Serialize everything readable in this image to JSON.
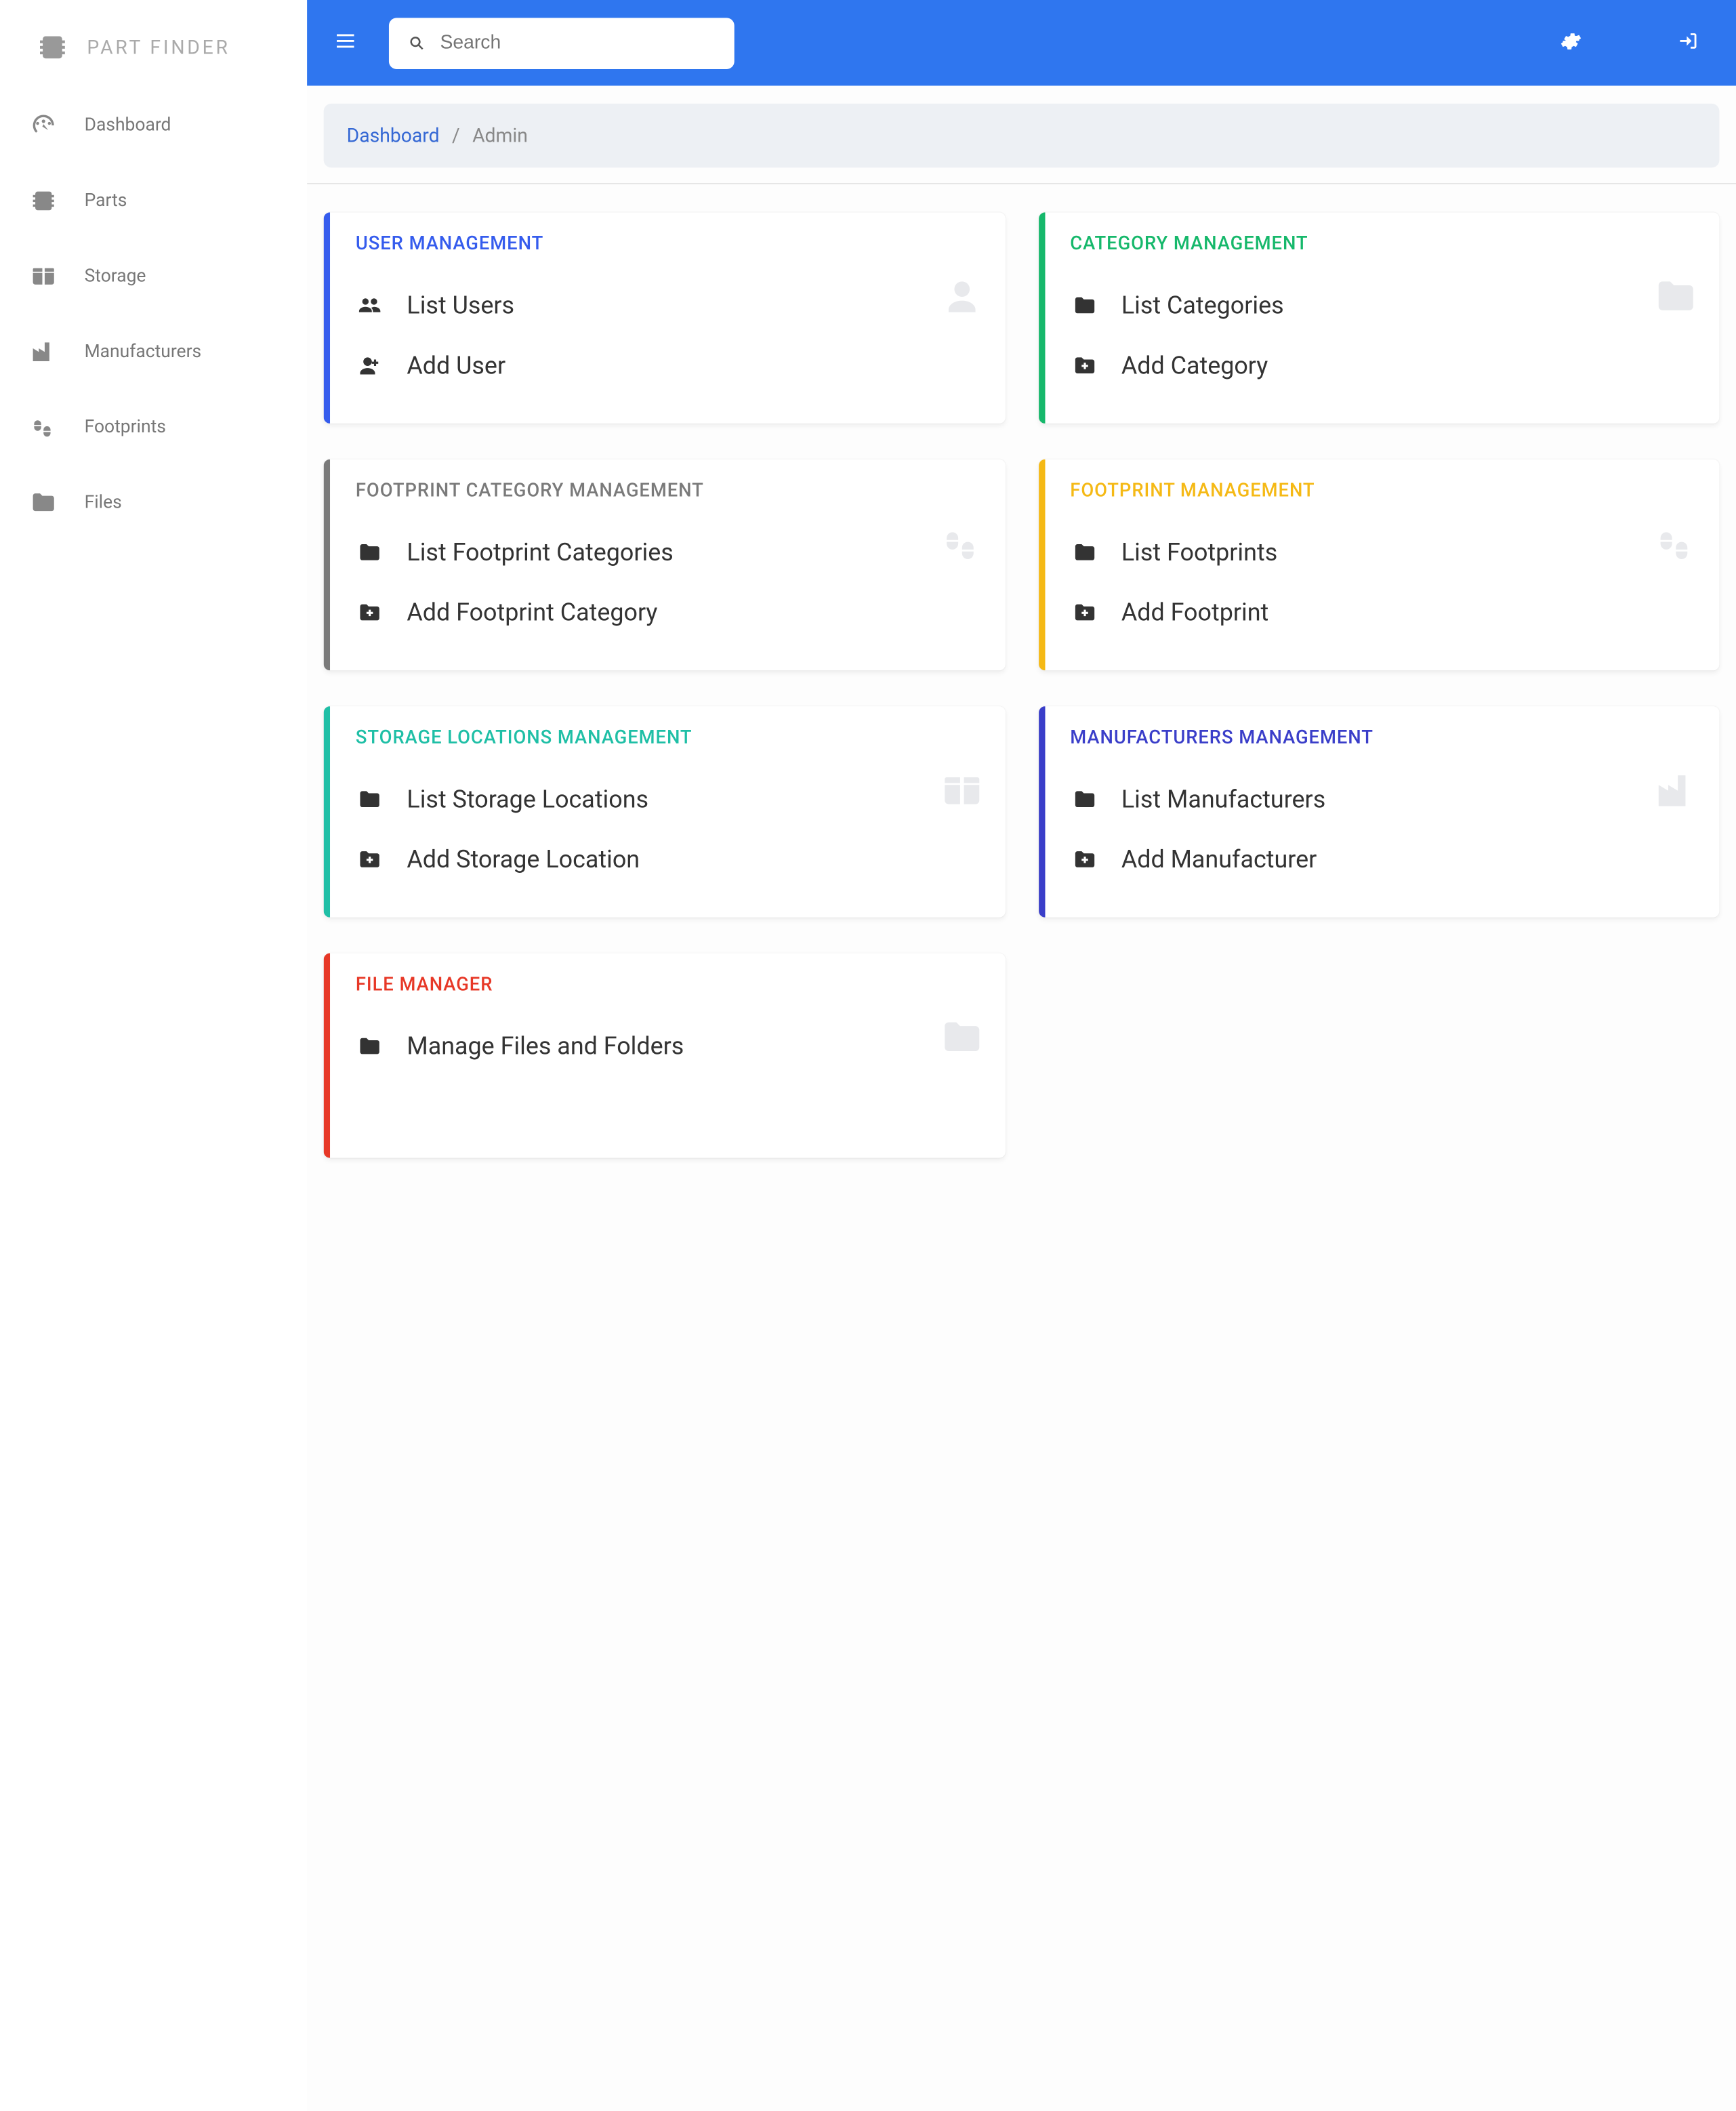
{
  "app": {
    "name": "PART FINDER"
  },
  "search": {
    "placeholder": "Search",
    "value": ""
  },
  "sidebar": {
    "items": [
      {
        "label": "Dashboard",
        "icon": "gauge"
      },
      {
        "label": "Parts",
        "icon": "chip"
      },
      {
        "label": "Storage",
        "icon": "box"
      },
      {
        "label": "Manufacturers",
        "icon": "factory"
      },
      {
        "label": "Footprints",
        "icon": "footprints"
      },
      {
        "label": "Files",
        "icon": "folder"
      }
    ]
  },
  "breadcrumb": {
    "root": "Dashboard",
    "current": "Admin"
  },
  "cards": [
    {
      "title": "USER MANAGEMENT",
      "accent": "blue",
      "bg_icon": "user",
      "links": [
        {
          "label": "List Users",
          "icon": "users"
        },
        {
          "label": "Add User",
          "icon": "user-plus"
        }
      ]
    },
    {
      "title": "CATEGORY MANAGEMENT",
      "accent": "green",
      "bg_icon": "folder",
      "links": [
        {
          "label": "List Categories",
          "icon": "folder"
        },
        {
          "label": "Add Category",
          "icon": "folder-plus"
        }
      ]
    },
    {
      "title": "FOOTPRINT CATEGORY MANAGEMENT",
      "accent": "gray",
      "bg_icon": "footprints",
      "links": [
        {
          "label": "List Footprint Categories",
          "icon": "folder"
        },
        {
          "label": "Add Footprint Category",
          "icon": "folder-plus"
        }
      ]
    },
    {
      "title": "FOOTPRINT MANAGEMENT",
      "accent": "yellow",
      "bg_icon": "footprints",
      "links": [
        {
          "label": "List Footprints",
          "icon": "folder"
        },
        {
          "label": "Add Footprint",
          "icon": "folder-plus"
        }
      ]
    },
    {
      "title": "STORAGE LOCATIONS MANAGEMENT",
      "accent": "teal",
      "bg_icon": "box",
      "links": [
        {
          "label": "List Storage Locations",
          "icon": "folder"
        },
        {
          "label": "Add Storage Location",
          "icon": "folder-plus"
        }
      ]
    },
    {
      "title": "MANUFACTURERS MANAGEMENT",
      "accent": "indigo",
      "bg_icon": "factory",
      "links": [
        {
          "label": "List Manufacturers",
          "icon": "folder"
        },
        {
          "label": "Add Manufacturer",
          "icon": "folder-plus"
        }
      ]
    },
    {
      "title": "FILE MANAGER",
      "accent": "red",
      "bg_icon": "folder",
      "links": [
        {
          "label": "Manage Files and Folders",
          "icon": "folder"
        }
      ]
    }
  ]
}
